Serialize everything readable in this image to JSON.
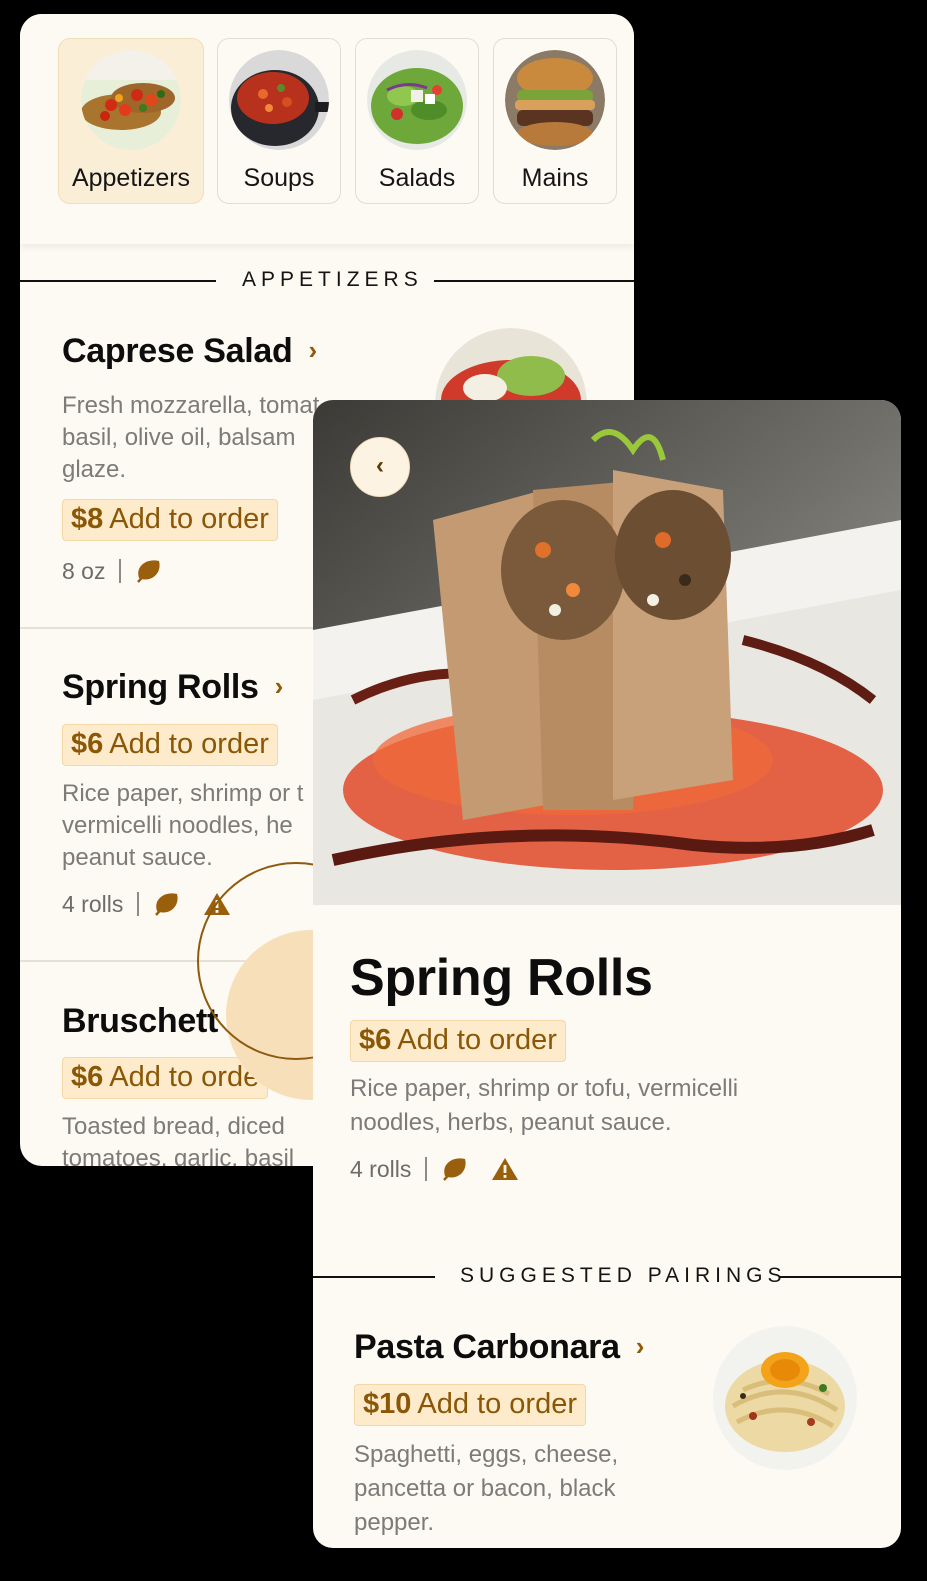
{
  "menu": {
    "categories": [
      {
        "label": "Appetizers",
        "icon": "bruschetta-photo",
        "active": true
      },
      {
        "label": "Soups",
        "icon": "soup-pot-photo",
        "active": false
      },
      {
        "label": "Salads",
        "icon": "salad-photo",
        "active": false
      },
      {
        "label": "Mains",
        "icon": "burger-photo",
        "active": false
      }
    ],
    "section_title": "APPETIZERS",
    "items": [
      {
        "title": "Caprese Salad",
        "price": "$8",
        "add_label": "Add to order",
        "description": "Fresh mozzarella, tomat basil, olive oil, balsam glaze.",
        "desc_lines": [
          "Fresh mozzarella, tomat",
          "basil, olive oil, balsam",
          "glaze."
        ],
        "portion": "8 oz",
        "icons": [
          "vegetarian-leaf-icon"
        ]
      },
      {
        "title": "Spring Rolls",
        "price": "$6",
        "add_label": "Add to order",
        "desc_lines": [
          "Rice paper, shrimp or t",
          "vermicelli noodles, he",
          "peanut sauce."
        ],
        "portion": "4 rolls",
        "icons": [
          "vegetarian-leaf-icon",
          "allergen-warning-icon"
        ]
      },
      {
        "title": "Bruschett",
        "price": "$6",
        "add_label": "Add to orde",
        "desc_lines": [
          "Toasted bread, diced",
          "tomatoes, garlic, basil"
        ]
      }
    ]
  },
  "detail": {
    "back_icon": "chevron-left-icon",
    "title": "Spring Rolls",
    "price": "$6",
    "add_label": "Add to order",
    "desc_lines": [
      "Rice paper, shrimp or tofu, vermicelli",
      "noodles, herbs, peanut sauce."
    ],
    "portion": "4 rolls",
    "icons": [
      "vegetarian-leaf-icon",
      "allergen-warning-icon"
    ],
    "pairings_title": "SUGGESTED PAIRINGS",
    "pairing": {
      "title": "Pasta Carbonara",
      "price": "$10",
      "add_label": "Add to order",
      "desc_lines": [
        "Spaghetti, eggs, cheese,",
        "pancetta or bacon, black",
        "pepper."
      ]
    }
  },
  "colors": {
    "background": "#fdfaf3",
    "accent": "#8a5706",
    "badge_bg": "#fdebcb",
    "icon_brown": "#9a5f0c"
  }
}
